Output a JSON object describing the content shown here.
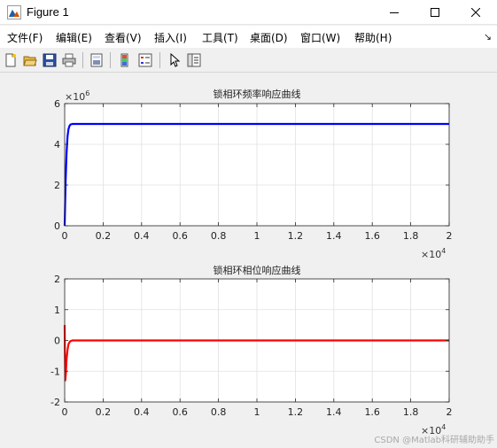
{
  "window": {
    "title": "Figure 1",
    "icon": "matlab-figure-icon",
    "controls": [
      "minimize-icon",
      "maximize-icon",
      "close-icon"
    ]
  },
  "menu": {
    "items": [
      "文件(F)",
      "编辑(E)",
      "查看(V)",
      "插入(I)",
      "工具(T)",
      "桌面(D)",
      "窗口(W)",
      "帮助(H)"
    ],
    "overflow_icon": "dock-arrow-icon"
  },
  "toolbar": {
    "icons": [
      "new-figure-icon",
      "open-file-icon",
      "save-icon",
      "print-icon",
      "print-preview-icon",
      "colorbar-icon",
      "legend-icon",
      "edit-plot-arrow-icon",
      "property-inspector-icon"
    ]
  },
  "watermark": "CSDN @Matlab科研辅助助手",
  "chart_data": [
    {
      "type": "line",
      "title": "锁相环频率响应曲线",
      "xlim": [
        0,
        20000
      ],
      "ylim": [
        0,
        6000000
      ],
      "x_ticks": [
        "0",
        "0.2",
        "0.4",
        "0.6",
        "0.8",
        "1",
        "1.2",
        "1.4",
        "1.6",
        "1.8",
        "2"
      ],
      "y_ticks": [
        "0",
        "2",
        "4",
        "6"
      ],
      "x_exponent": "×10",
      "x_exponent_power": "4",
      "y_exponent": "×10",
      "y_exponent_power": "6",
      "grid": true,
      "series": [
        {
          "color": "#0000ff",
          "x": [
            0,
            50,
            100,
            150,
            200,
            250,
            300,
            400,
            500,
            700,
            1000,
            2000,
            5000,
            10000,
            15000,
            20000
          ],
          "y": [
            0,
            2200000,
            3600000,
            4400000,
            4750000,
            4900000,
            4970000,
            5000000,
            5000000,
            5000000,
            5000000,
            5000000,
            5000000,
            5000000,
            5000000,
            5000000
          ]
        }
      ]
    },
    {
      "type": "line",
      "title": "锁相环相位响应曲线",
      "xlim": [
        0,
        20000
      ],
      "ylim": [
        -2,
        2
      ],
      "x_ticks": [
        "0",
        "0.2",
        "0.4",
        "0.6",
        "0.8",
        "1",
        "1.2",
        "1.4",
        "1.6",
        "1.8",
        "2"
      ],
      "y_ticks": [
        "-2",
        "-1",
        "0",
        "1",
        "2"
      ],
      "x_exponent": "×10",
      "x_exponent_power": "4",
      "grid": true,
      "series": [
        {
          "color": "#ff0000",
          "x": [
            0,
            10,
            30,
            60,
            100,
            150,
            200,
            260,
            320,
            400,
            500,
            700,
            1000,
            5000,
            10000,
            15000,
            20000
          ],
          "y": [
            0.5,
            -0.3,
            -1.3,
            -1.1,
            -0.6,
            -0.3,
            -0.12,
            -0.05,
            -0.02,
            0,
            0,
            0,
            0,
            0,
            0,
            0,
            0
          ]
        }
      ]
    }
  ]
}
